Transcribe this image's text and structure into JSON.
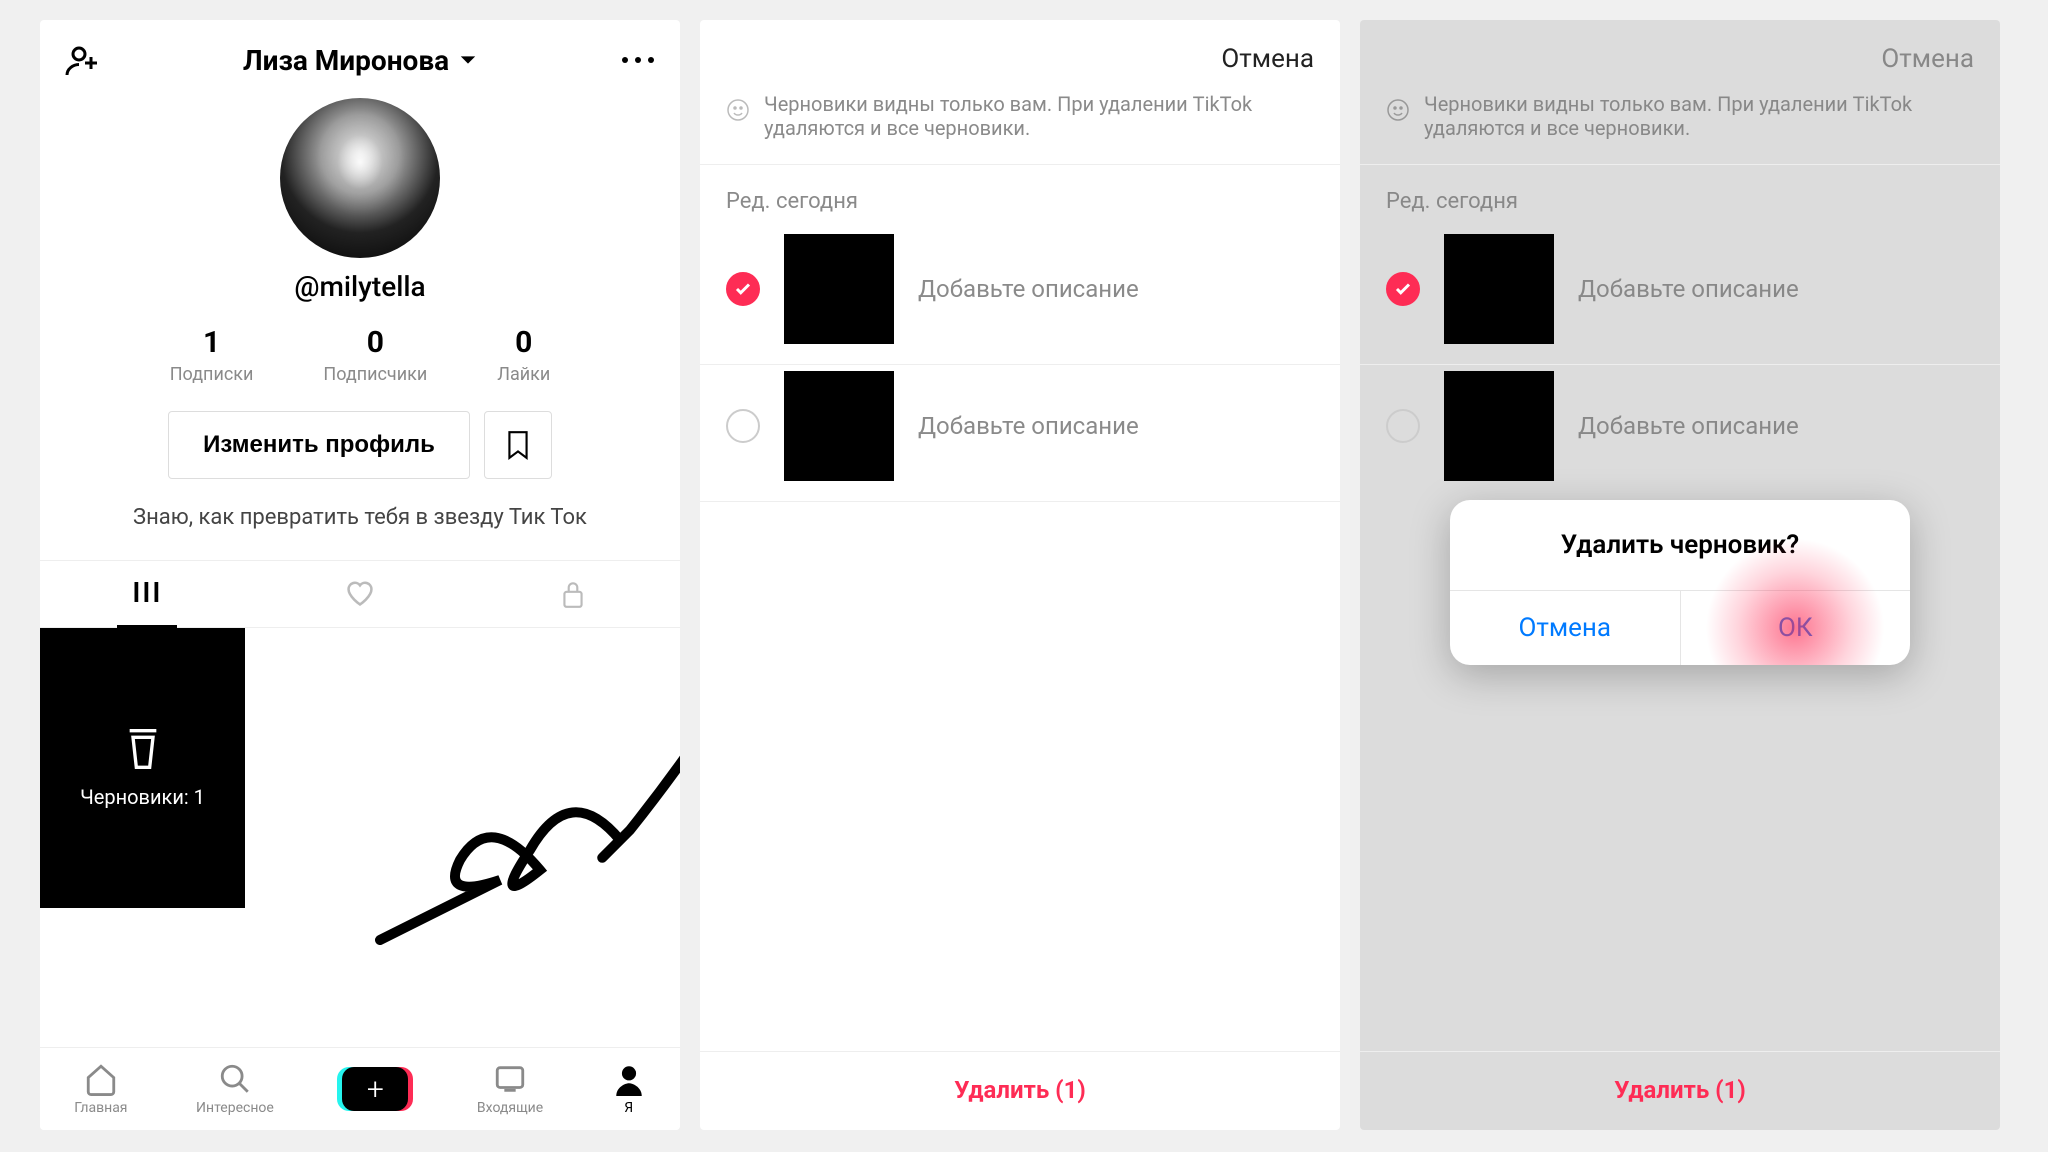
{
  "screen1": {
    "header": {
      "title": "Лиза Миронова"
    },
    "username": "@milytella",
    "stats": {
      "following": {
        "n": "1",
        "l": "Подписки"
      },
      "followers": {
        "n": "0",
        "l": "Подписчики"
      },
      "likes": {
        "n": "0",
        "l": "Лайки"
      }
    },
    "edit_label": "Изменить профиль",
    "bio": "Знаю, как превратить тебя в звезду Тик Ток",
    "drafts_tile": "Черновики: 1",
    "nav": {
      "home": "Главная",
      "discover": "Интересное",
      "inbox": "Входящие",
      "me": "Я"
    }
  },
  "screen2": {
    "cancel": "Отмена",
    "info": "Черновики видны только вам. При удалении TikTok удаляются и все черновики.",
    "section": "Ред. сегодня",
    "draft_desc": "Добавьте описание",
    "delete_label": "Удалить (1)"
  },
  "screen3": {
    "cancel": "Отмена",
    "info": "Черновики видны только вам. При удалении TikTok удаляются и все черновики.",
    "section": "Ред. сегодня",
    "draft_desc": "Добавьте описание",
    "delete_label": "Удалить (1)",
    "dialog": {
      "title": "Удалить черновик?",
      "cancel": "Отмена",
      "ok": "ОК"
    }
  }
}
